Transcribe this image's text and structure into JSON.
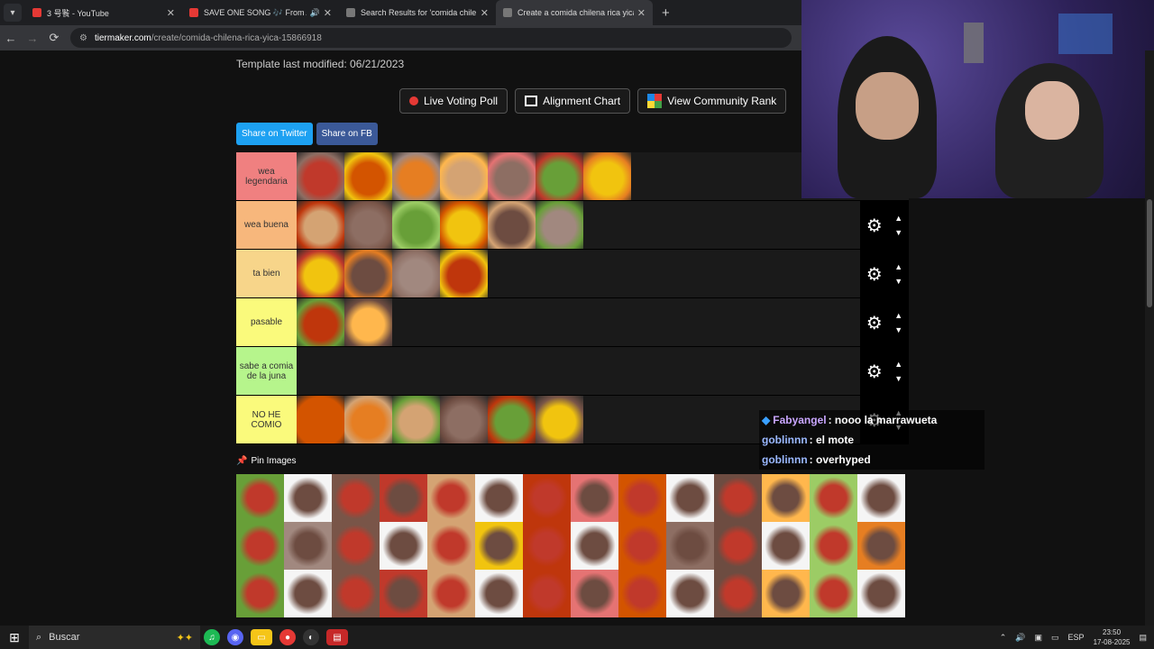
{
  "tabs": [
    {
      "title": "3 号䭆 - YouTube",
      "favicon_color": "#e53935",
      "active": false,
      "audio": false
    },
    {
      "title": "SAVE ONE SONG 🎶 From A to",
      "favicon_color": "#e53935",
      "active": false,
      "audio": true
    },
    {
      "title": "Search Results for 'comida chile",
      "favicon_color": "#4a4a4a",
      "active": false,
      "audio": false
    },
    {
      "title": "Create a comida chilena rica yica",
      "favicon_color": "#4a4a4a",
      "active": true,
      "audio": false
    }
  ],
  "address": {
    "host": "tiermaker.com",
    "path": "/create/comida-chilena-rica-yica-15866918"
  },
  "page": {
    "modified": "Template last modified: 06/21/2023",
    "buttons": [
      "Live Voting Poll",
      "Alignment Chart",
      "View Community Rank"
    ],
    "share": [
      "Share on Twitter",
      "Share on FB"
    ],
    "pin_label": "Pin Images"
  },
  "tiers": [
    {
      "label": "wea legendaria",
      "color": "#f08080",
      "items": 7
    },
    {
      "label": "wea buena",
      "color": "#f7b77c",
      "items": 6
    },
    {
      "label": "ta bien",
      "color": "#f7d58a",
      "items": 4
    },
    {
      "label": "pasable",
      "color": "#fafa7c",
      "items": 2
    },
    {
      "label": "sabe a comia de la juna",
      "color": "#b6f58c",
      "items": 0
    },
    {
      "label": "NO HE COMIO",
      "color": "#fafa7c",
      "items": 6
    }
  ],
  "chat": [
    {
      "user": "Fabyangel",
      "text": ": nooo la marrawueta",
      "color": "#c9a6ff"
    },
    {
      "user": "goblinnn",
      "text": ": el mote",
      "color": "#9ab8ff"
    },
    {
      "user": "goblinnn",
      "text": ": overhyped",
      "color": "#9ab8ff"
    }
  ],
  "taskbar": {
    "search_placeholder": "Buscar",
    "lang": "ESP",
    "time": "23:50",
    "date": "17-08-2025"
  }
}
